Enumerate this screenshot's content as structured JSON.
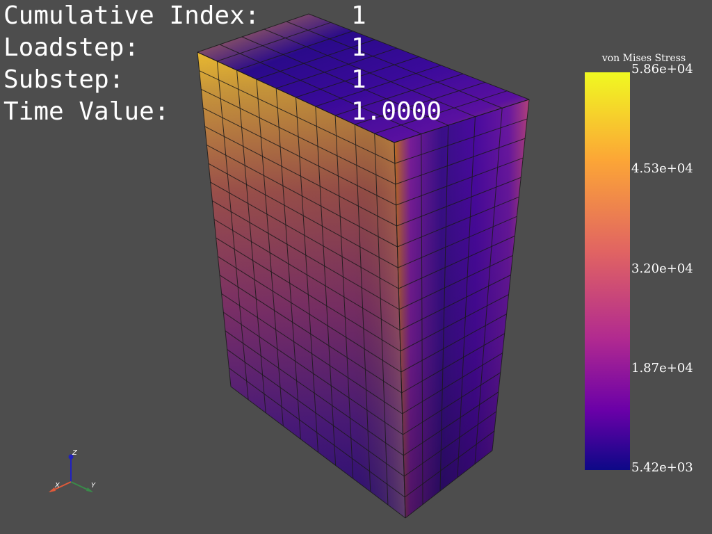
{
  "hud": {
    "cumulative_index_label": "Cumulative Index:",
    "cumulative_index_value": "1",
    "loadstep_label": "Loadstep:",
    "loadstep_value": "1",
    "substep_label": "Substep:",
    "substep_value": "1",
    "time_value_label": "Time Value:",
    "time_value_value": "1.0000"
  },
  "colorbar": {
    "title": "von Mises Stress",
    "max_label": "5.86e+04",
    "tick_2": "4.53e+04",
    "tick_3": "3.20e+04",
    "tick_4": "1.87e+04",
    "min_label": "5.42e+03",
    "colormap": "plasma",
    "colors": [
      "#0d0887",
      "#6a00a8",
      "#b12a90",
      "#e16462",
      "#fca636",
      "#f0f921"
    ]
  },
  "model": {
    "grid": {
      "front_cols": 10,
      "front_rows": 18,
      "side_cols": 5,
      "depth_rows": 5
    }
  },
  "axes_widget": {
    "x_label": "X",
    "y_label": "Y",
    "z_label": "Z"
  },
  "colors": {
    "background": "#4d4d4d",
    "edge": "#1a1a1a",
    "axis_x": "#e05a3a",
    "axis_y": "#3a8a4a",
    "axis_z": "#2020c0"
  }
}
